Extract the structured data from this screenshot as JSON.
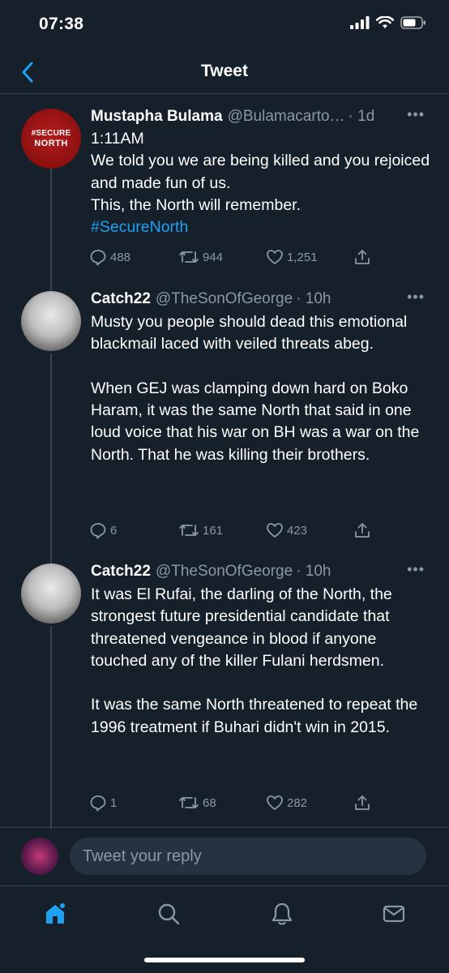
{
  "status": {
    "time": "07:38"
  },
  "header": {
    "title": "Tweet"
  },
  "tweets": [
    {
      "avatar_line1": "#SECURE",
      "avatar_line2": "NORTH",
      "name": "Mustapha Bulama",
      "handle": "@Bulamacarto…",
      "time": "· 1d",
      "body": "1:11AM\nWe told you we are being killed and you rejoiced and made fun of us.\nThis, the North will remember.",
      "hashtag": "#SecureNorth",
      "replies": "488",
      "retweets": "944",
      "likes": "1,251"
    },
    {
      "name": "Catch22",
      "handle": "@TheSonOfGeorge",
      "time": "· 10h",
      "body": "Musty you people should dead this emotional blackmail laced with veiled threats abeg.\n\nWhen GEJ was clamping down hard on Boko Haram, it was the same North that said in one loud voice that his war on BH was a war on the North. That he was killing their brothers.",
      "replies": "6",
      "retweets": "161",
      "likes": "423"
    },
    {
      "name": "Catch22",
      "handle": "@TheSonOfGeorge",
      "time": "· 10h",
      "body": "It was El Rufai, the darling of the North, the strongest future presidential candidate that threatened vengeance in blood if anyone touched any of the killer Fulani herdsmen.\n\nIt was the same North threatened to repeat the 1996 treatment if Buhari didn't win in 2015.",
      "replies": "1",
      "retweets": "68",
      "likes": "282"
    }
  ],
  "reply": {
    "placeholder": "Tweet your reply"
  },
  "tabs": [
    "home-icon",
    "search-icon",
    "notifications-icon",
    "messages-icon"
  ],
  "colors": {
    "background": "#15202b",
    "accent": "#1da1f2",
    "muted": "#8899a6",
    "divider": "#38444d"
  }
}
